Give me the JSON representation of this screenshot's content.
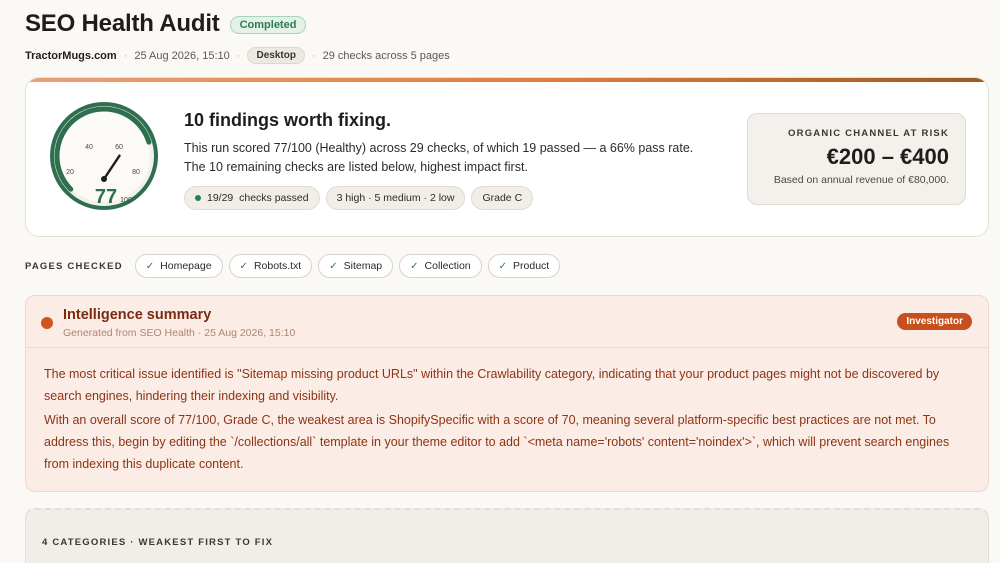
{
  "header": {
    "title": "SEO Health Audit",
    "status": "Completed",
    "site": "TractorMugs.com",
    "datetime": "25 Aug 2026, 15:10",
    "device": "Desktop",
    "checks_summary": "29 checks across 5 pages"
  },
  "score_card": {
    "score": 77,
    "score_max": 100,
    "gauge_ticks": [
      "20",
      "40",
      "60",
      "80",
      "100"
    ],
    "findings_title": "10 findings worth fixing.",
    "description_line1": "This run scored 77/100 (Healthy) across 29 checks, of which 19 passed — a 66% pass rate.",
    "description_line2": "The 10 remaining checks are listed below, highest impact first.",
    "chips": {
      "passed": "19/29  checks passed",
      "severity": "3 high · 5 medium · 2 low",
      "grade": "Grade C"
    },
    "risk": {
      "label": "ORGANIC CHANNEL AT RISK",
      "value": "€200 – €400",
      "note": "Based on annual revenue of €80,000."
    }
  },
  "pages_checked": {
    "label": "PAGES CHECKED",
    "items": [
      "Homepage",
      "Robots.txt",
      "Sitemap",
      "Collection",
      "Product"
    ]
  },
  "intelligence": {
    "title": "Intelligence summary",
    "subtitle": "Generated from SEO Health · 25 Aug 2026, 15:10",
    "badge": "Investigator",
    "paragraph1": "The most critical issue identified is \"Sitemap missing product URLs\" within the Crawlability category, indicating that your product pages might not be discovered by search engines, hindering their indexing and visibility.",
    "paragraph2": "With an overall score of 77/100, Grade C, the weakest area is ShopifySpecific with a score of 70, meaning several platform-specific best practices are not met. To address this, begin by editing the `/collections/all` template in your theme editor to add `<meta name='robots' content='noindex'>`, which will prevent search engines from indexing this duplicate content."
  },
  "categories": {
    "label": "4 CATEGORIES · WEAKEST FIRST TO FIX"
  },
  "colors": {
    "accent": "#c8501e",
    "success": "#2f7a57",
    "background": "#fbf9f6"
  }
}
